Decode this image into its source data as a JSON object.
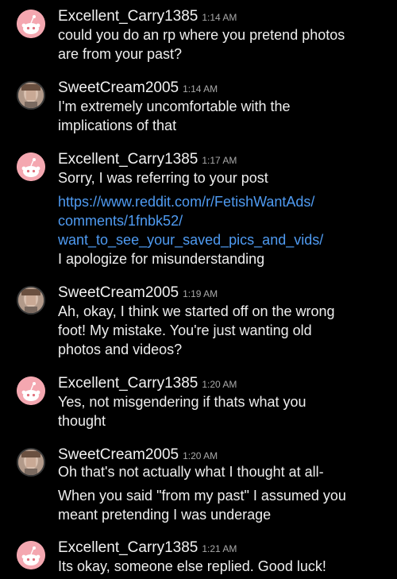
{
  "colors": {
    "background": "#000000",
    "username": "#f2f2f2",
    "timestamp": "#a9a9a9",
    "message_text": "#eeeeee",
    "link": "#4f9bf2",
    "reddit_avatar_bg": "#f4a7b0"
  },
  "messages": [
    {
      "username": "Excellent_Carry1385",
      "time": "1:14 AM",
      "avatar": "reddit-snoo-avatar",
      "lines": [
        "could you do an rp where you pretend photos",
        "are from your past?"
      ]
    },
    {
      "username": "SweetCream2005",
      "time": "1:14 AM",
      "avatar": "user-photo-avatar",
      "lines": [
        "I'm extremely uncomfortable with the",
        "implications of that"
      ]
    },
    {
      "username": "Excellent_Carry1385",
      "time": "1:17 AM",
      "avatar": "reddit-snoo-avatar",
      "lines": [
        "Sorry, I was referring to your post"
      ],
      "link_lines": [
        "https://www.reddit.com/r/FetishWantAds/",
        "comments/1fnbk52/",
        "want_to_see_your_saved_pics_and_vids/"
      ],
      "after_lines": [
        "I apologize for misunderstanding"
      ]
    },
    {
      "username": "SweetCream2005",
      "time": "1:19 AM",
      "avatar": "user-photo-avatar",
      "lines": [
        "Ah, okay, I think we started off on the wrong",
        "foot! My mistake. You're just wanting old",
        "photos and videos?"
      ]
    },
    {
      "username": "Excellent_Carry1385",
      "time": "1:20 AM",
      "avatar": "reddit-snoo-avatar",
      "lines": [
        "Yes, not misgendering if thats what you",
        "thought"
      ]
    },
    {
      "username": "SweetCream2005",
      "time": "1:20 AM",
      "avatar": "user-photo-avatar",
      "lines": [
        "Oh that's not actually what I thought at all-"
      ],
      "after_lines": [
        "When you said \"from my past\" I assumed you",
        "meant pretending I was underage"
      ]
    },
    {
      "username": "Excellent_Carry1385",
      "time": "1:21 AM",
      "avatar": "reddit-snoo-avatar",
      "lines": [
        "Its okay, someone else replied. Good luck!"
      ]
    }
  ]
}
